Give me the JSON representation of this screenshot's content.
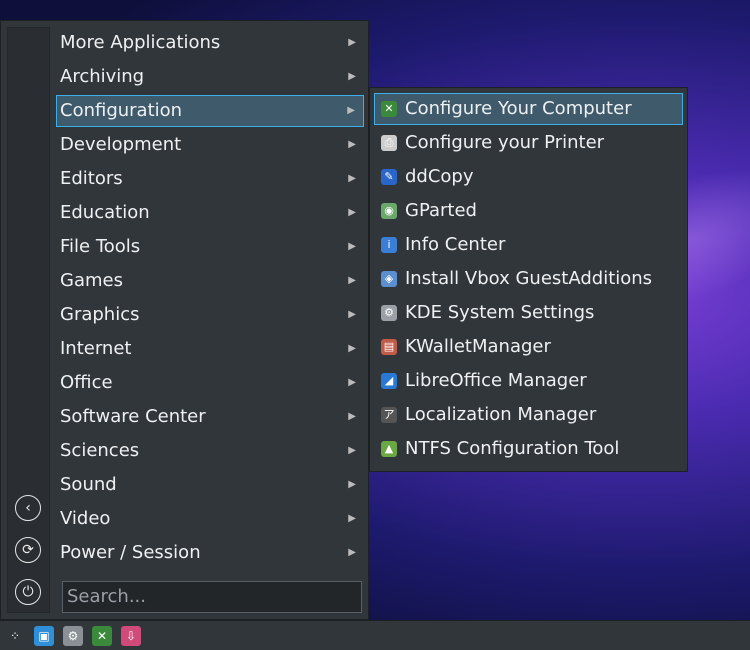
{
  "categories": [
    {
      "label": "More Applications",
      "active": false
    },
    {
      "label": "Archiving",
      "active": false
    },
    {
      "label": "Configuration",
      "active": true
    },
    {
      "label": "Development",
      "active": false
    },
    {
      "label": "Editors",
      "active": false
    },
    {
      "label": "Education",
      "active": false
    },
    {
      "label": "File Tools",
      "active": false
    },
    {
      "label": "Games",
      "active": false
    },
    {
      "label": "Graphics",
      "active": false
    },
    {
      "label": "Internet",
      "active": false
    },
    {
      "label": "Office",
      "active": false
    },
    {
      "label": "Software Center",
      "active": false
    },
    {
      "label": "Sciences",
      "active": false
    },
    {
      "label": "Sound",
      "active": false
    },
    {
      "label": "Video",
      "active": false
    },
    {
      "label": "Power / Session",
      "active": false
    }
  ],
  "submenu": [
    {
      "label": "Configure Your Computer",
      "icon": "configure-computer-icon",
      "color": "#3b8a3b",
      "glyph": "✕",
      "active": true
    },
    {
      "label": "Configure your Printer",
      "icon": "printer-icon",
      "color": "#cccccc",
      "glyph": "⎙",
      "active": false
    },
    {
      "label": "ddCopy",
      "icon": "syringe-icon",
      "color": "#2a66c9",
      "glyph": "✎",
      "active": false
    },
    {
      "label": "GParted",
      "icon": "gparted-icon",
      "color": "#6aa86a",
      "glyph": "◉",
      "active": false
    },
    {
      "label": "Info Center",
      "icon": "info-center-icon",
      "color": "#3a7fd5",
      "glyph": "i",
      "active": false
    },
    {
      "label": "Install Vbox GuestAdditions",
      "icon": "virtualbox-icon",
      "color": "#5b8fd0",
      "glyph": "◈",
      "active": false
    },
    {
      "label": "KDE System Settings",
      "icon": "system-settings-icon",
      "color": "#9aa0a6",
      "glyph": "⚙",
      "active": false
    },
    {
      "label": "KWalletManager",
      "icon": "kwallet-icon",
      "color": "#c35b4a",
      "glyph": "▤",
      "active": false
    },
    {
      "label": "LibreOffice Manager",
      "icon": "libreoffice-icon",
      "color": "#2a7ad5",
      "glyph": "◢",
      "active": false
    },
    {
      "label": "Localization Manager",
      "icon": "localization-icon",
      "color": "#555555",
      "glyph": "ア",
      "active": false
    },
    {
      "label": "NTFS Configuration Tool",
      "icon": "ntfs-tool-icon",
      "color": "#6aa843",
      "glyph": "▲",
      "active": false
    }
  ],
  "search": {
    "placeholder": "Search..."
  },
  "side_buttons": [
    {
      "icon": "back-icon",
      "glyph": "‹"
    },
    {
      "icon": "refresh-icon",
      "glyph": "⟳"
    },
    {
      "icon": "power-icon",
      "glyph": "⏻"
    }
  ],
  "taskbar": [
    {
      "icon": "menu-launcher-icon",
      "color": "#31363b",
      "glyph": "⁘"
    },
    {
      "icon": "file-manager-icon",
      "color": "#2f8fd8",
      "glyph": "▣"
    },
    {
      "icon": "system-settings-icon",
      "color": "#8a9096",
      "glyph": "⚙"
    },
    {
      "icon": "configure-computer-icon",
      "color": "#3b8a3b",
      "glyph": "✕"
    },
    {
      "icon": "installer-icon",
      "color": "#d04a7a",
      "glyph": "⇩"
    }
  ]
}
